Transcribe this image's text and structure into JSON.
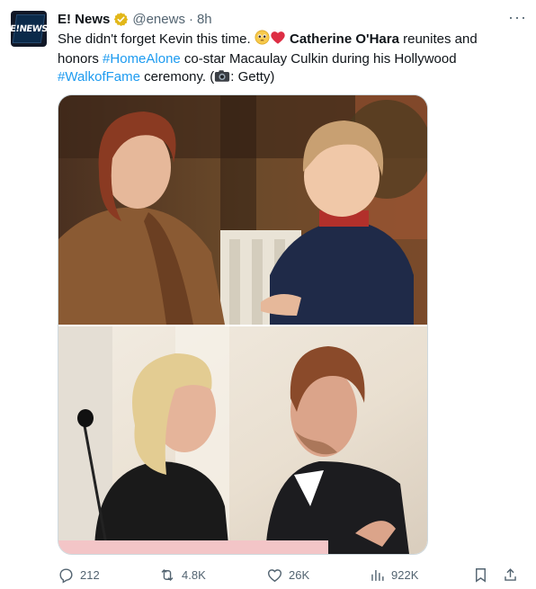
{
  "tweet": {
    "author_name": "E! News",
    "handle": "@enews",
    "time": "8h",
    "avatar_text": "E!NEWS",
    "text": {
      "part1": "She didn't forget Kevin this time. ",
      "emoji1": "🥺",
      "emoji2": "❤️",
      "mention": "Catherine O'Hara",
      "part2": " reunites and honors ",
      "hashtag1": "#HomeAlone",
      "part3": " co-star Macaulay Culkin during his Hollywood ",
      "hashtag2": "#WalkofFame",
      "part4": " ceremony. (",
      "camera_emoji": "📷",
      "part5": ": Getty)"
    },
    "more_label": "···",
    "media": {
      "photo1": "photo-kitchen-scene",
      "photo2": "photo-ceremony-embrace"
    },
    "actions": {
      "replies": "212",
      "reposts": "4.8K",
      "likes": "26K",
      "views": "922K"
    },
    "colors": {
      "link": "#1d9bf0",
      "verified": "#e2b719",
      "muted": "#536471"
    },
    "icons": [
      "verified-badge-icon",
      "more-icon",
      "reply-icon",
      "repost-icon",
      "like-icon",
      "views-icon",
      "bookmark-icon",
      "share-icon"
    ]
  }
}
